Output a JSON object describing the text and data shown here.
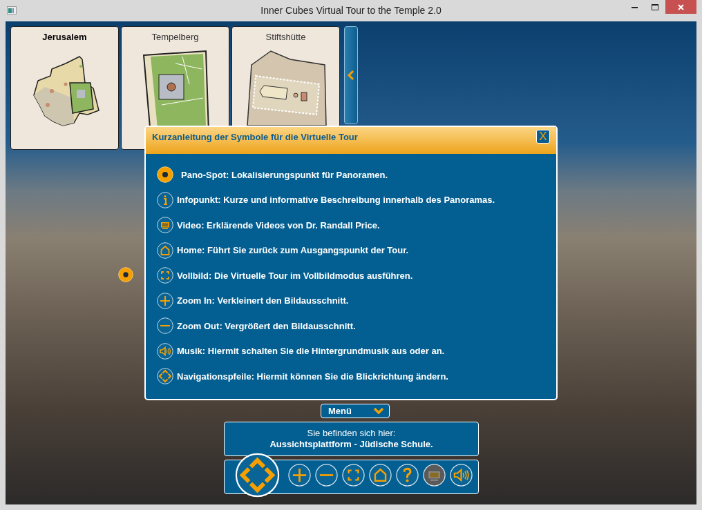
{
  "window": {
    "title": "Inner Cubes Virtual Tour to the Temple 2.0"
  },
  "map_tabs": [
    {
      "label": "Jerusalem",
      "selected": true
    },
    {
      "label": "Tempelberg",
      "selected": false
    },
    {
      "label": "Stiftshütte",
      "selected": false
    }
  ],
  "dialog": {
    "title": "Kurzanleitung der Symbole für die Virtuelle Tour",
    "close": "X",
    "items": [
      {
        "kind": "pano",
        "text": "Pano-Spot: Lokalisierungspunkt für Panoramen."
      },
      {
        "kind": "info",
        "text": "Infopunkt: Kurze und informative Beschreibung innerhalb des Panoramas."
      },
      {
        "kind": "video",
        "text": "Video: Erklärende Videos von Dr. Randall Price."
      },
      {
        "kind": "home",
        "text": "Home: Führt Sie zurück zum Ausgangspunkt der Tour."
      },
      {
        "kind": "fullscreen",
        "text": "Vollbild: Die Virtuelle Tour im Vollbildmodus ausführen."
      },
      {
        "kind": "zoom-in",
        "text": "Zoom In: Verkleinert den Bildausschnitt."
      },
      {
        "kind": "zoom-out",
        "text": "Zoom Out: Vergrößert den Bildausschnitt."
      },
      {
        "kind": "music",
        "text": "Musik: Hiermit schalten Sie die Hintergrundmusik aus oder an."
      },
      {
        "kind": "nav",
        "text": "Navigationspfeile: Hiermit können Sie die Blickrichtung ändern."
      }
    ]
  },
  "menu_button": {
    "label": "Menü"
  },
  "location": {
    "caption": "Sie befinden sich hier:",
    "place": "Aussichtsplattform - Jüdische Schule."
  },
  "toolbar": [
    {
      "kind": "nav",
      "disabled": false
    },
    {
      "kind": "zoom-in",
      "disabled": false
    },
    {
      "kind": "zoom-out",
      "disabled": false
    },
    {
      "kind": "fullscreen",
      "disabled": false
    },
    {
      "kind": "home",
      "disabled": false
    },
    {
      "kind": "help",
      "disabled": false
    },
    {
      "kind": "video",
      "disabled": true
    },
    {
      "kind": "music",
      "disabled": false
    }
  ]
}
